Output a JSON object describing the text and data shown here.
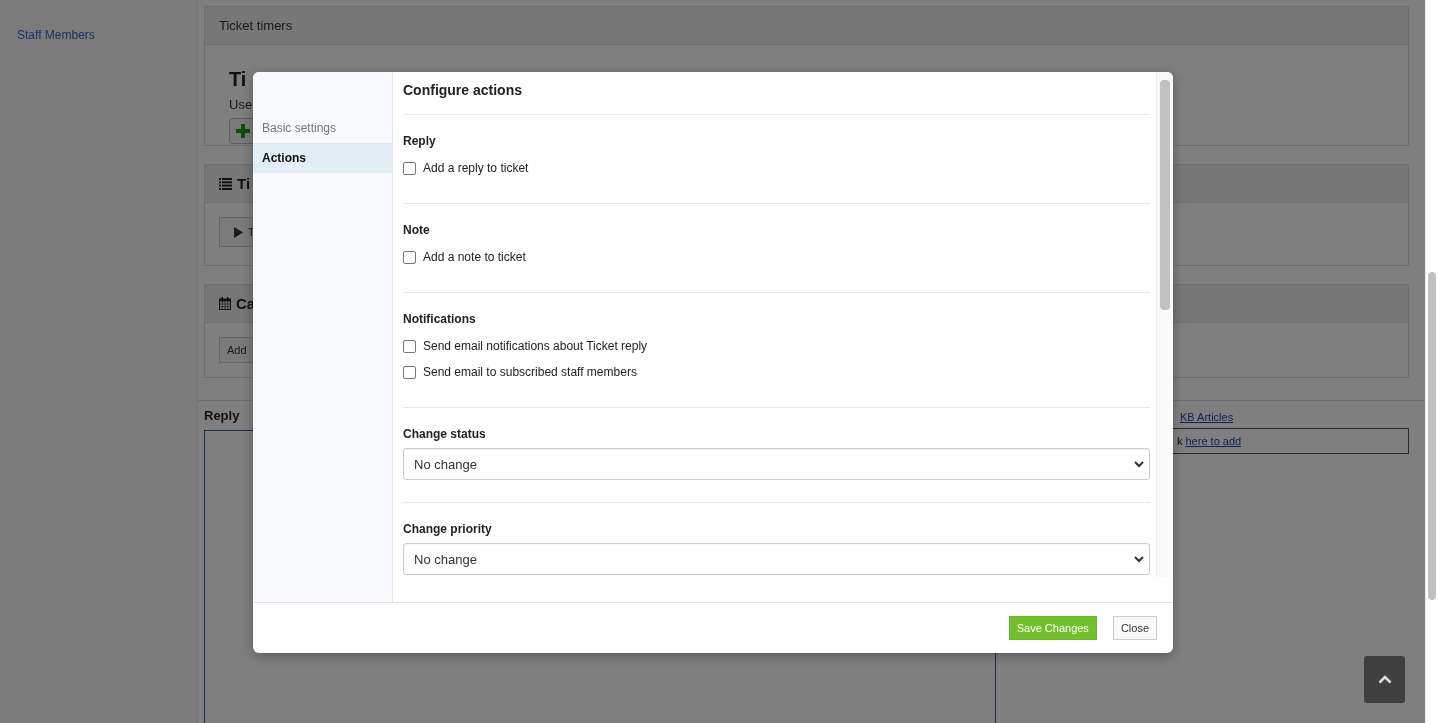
{
  "sidebar": {
    "items": [
      {
        "label": "Staff Members"
      }
    ]
  },
  "panels": [
    {
      "kind": "timers",
      "title": "Ticket timers",
      "heading": "Ti",
      "text": "Use"
    },
    {
      "kind": "list",
      "title": "Ti",
      "button": "T"
    },
    {
      "kind": "calendar",
      "title": "Ca",
      "button": "Add"
    }
  ],
  "reply": {
    "label": "Reply"
  },
  "kb": {
    "link": "KB Articles",
    "text": "k",
    "add_link": "here to add"
  },
  "modal": {
    "nav": [
      {
        "label": "Basic settings",
        "selected": false
      },
      {
        "label": "Actions",
        "selected": true
      }
    ],
    "title": "Configure actions",
    "sections": [
      {
        "kind": "checkboxes",
        "title": "Reply",
        "options": [
          {
            "label": "Add a reply to ticket",
            "checked": false
          }
        ]
      },
      {
        "kind": "checkboxes",
        "title": "Note",
        "options": [
          {
            "label": "Add a note to ticket",
            "checked": false
          }
        ]
      },
      {
        "kind": "checkboxes",
        "title": "Notifications",
        "options": [
          {
            "label": "Send email notifications about Ticket reply",
            "checked": false
          },
          {
            "label": "Send email to subscribed staff members",
            "checked": false
          }
        ]
      },
      {
        "kind": "select",
        "title": "Change status",
        "value": "No change"
      },
      {
        "kind": "select",
        "title": "Change priority",
        "value": "No change"
      }
    ],
    "buttons": [
      {
        "kind": "primary",
        "label": "Save Changes"
      },
      {
        "kind": "default",
        "label": "Close"
      }
    ]
  }
}
